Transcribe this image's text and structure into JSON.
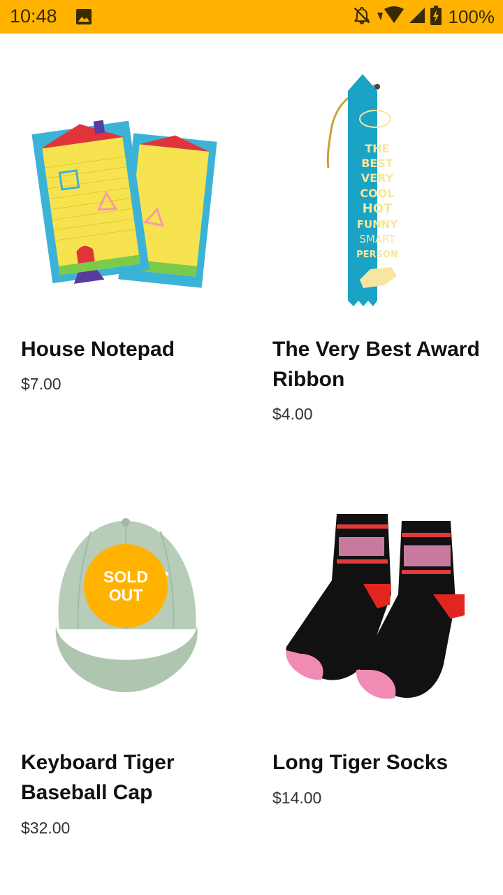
{
  "status_bar": {
    "time": "10:48",
    "battery_percent": "100%",
    "icons": [
      "image-icon",
      "notifications-off-icon",
      "wifi-icon",
      "signal-icon",
      "battery-charging-icon"
    ]
  },
  "products": [
    {
      "name": "House Notepad",
      "price": "$7.00",
      "image": "house-notepad-image"
    },
    {
      "name": "The Very Best Award Ribbon",
      "price": "$4.00",
      "image": "award-ribbon-image",
      "ribbon_text": [
        "THE",
        "BEST",
        "VERY",
        "COOL",
        "HOT",
        "FUNNY",
        "SMART",
        "PERSON"
      ]
    },
    {
      "name": "Keyboard Tiger Baseball Cap",
      "price": "$32.00",
      "image": "baseball-cap-image",
      "badge": {
        "line1": "SOLD",
        "line2": "OUT"
      }
    },
    {
      "name": "Long Tiger Socks",
      "price": "$14.00",
      "image": "tiger-socks-image"
    }
  ],
  "colors": {
    "status_bar": "#FFB300",
    "sold_out_badge": "#FFB300",
    "ribbon": "#1BA3C6",
    "cap": "#B8CDB9"
  }
}
